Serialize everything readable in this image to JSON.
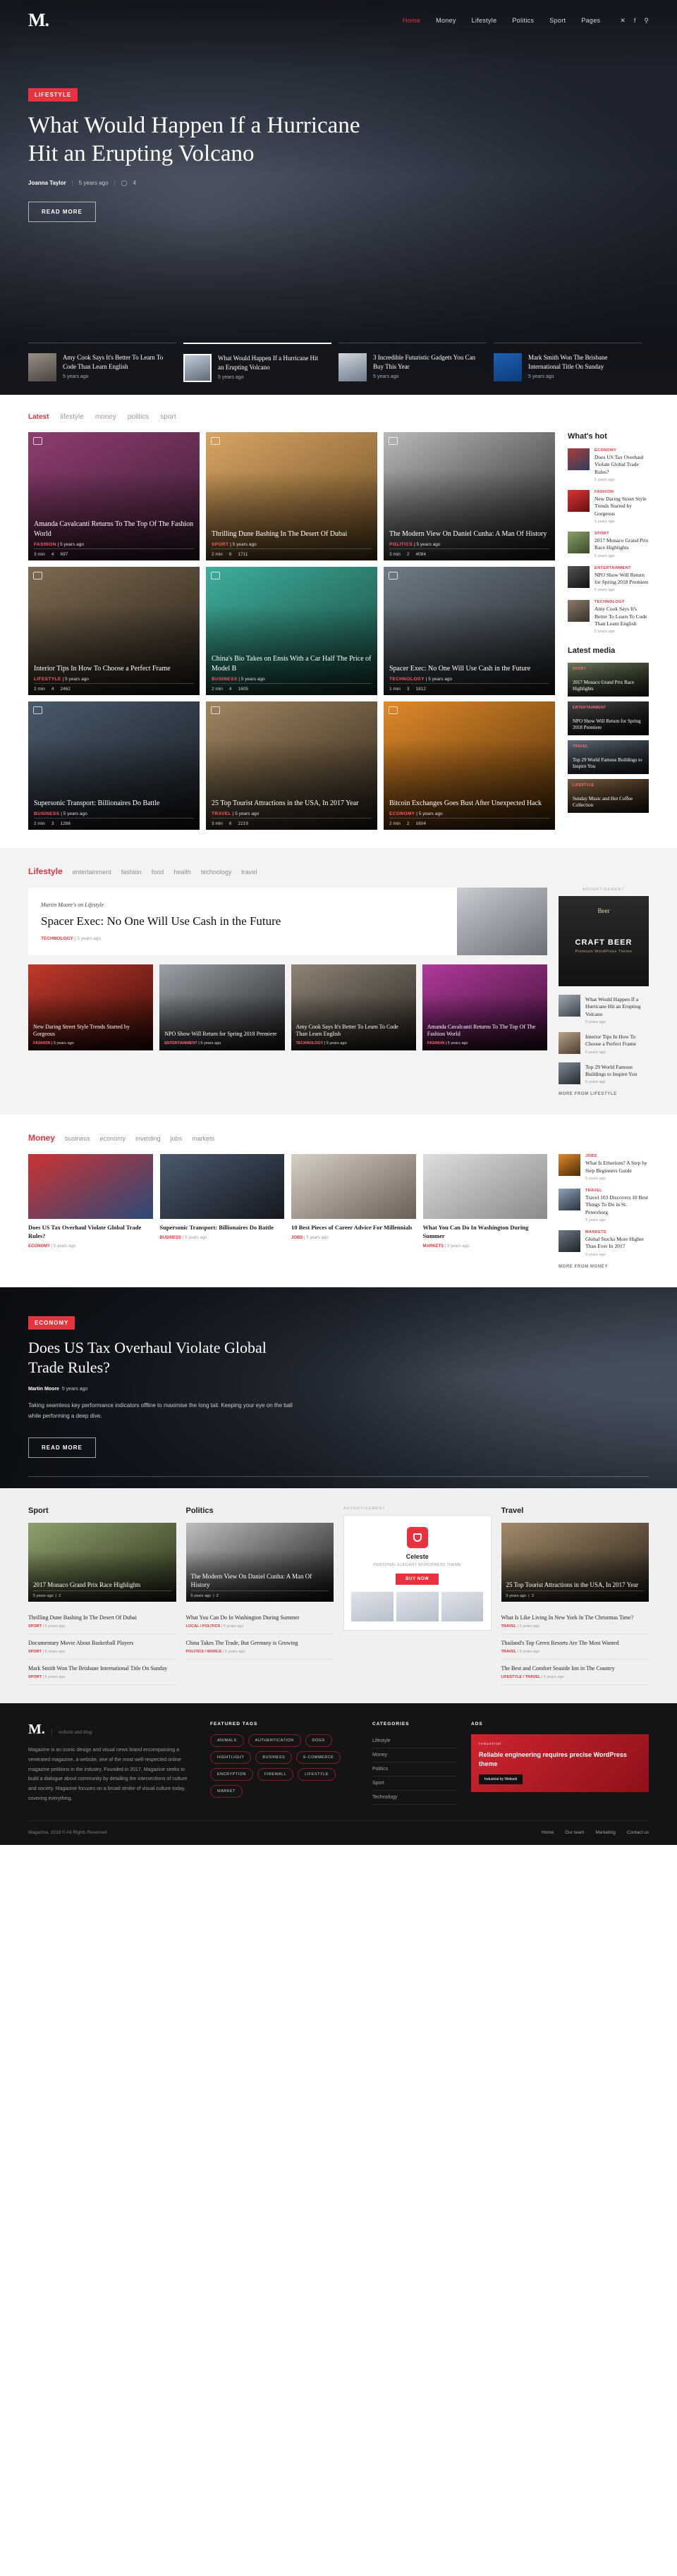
{
  "site": {
    "logo": "M.",
    "tagline": "website and blog"
  },
  "nav": {
    "items": [
      {
        "label": "Home",
        "active": true
      },
      {
        "label": "Money",
        "active": false
      },
      {
        "label": "Lifestyle",
        "active": false
      },
      {
        "label": "Politics",
        "active": false
      },
      {
        "label": "Sport",
        "active": false
      },
      {
        "label": "Pages",
        "active": false
      }
    ],
    "icons": [
      "twitter-icon",
      "facebook-icon",
      "search-icon"
    ],
    "icon_glyphs": [
      "✕",
      "f",
      "⚲"
    ]
  },
  "hero": {
    "badge": "LIFESTYLE",
    "title": "What Would Happen If a Hurricane Hit an Erupting Volcano",
    "author": "Joanna Taylor",
    "date": "5 years ago",
    "comments": "4",
    "button": "READ MORE",
    "carousel": [
      {
        "title": "Amy Cook Says It's Better To Learn To Code Than Learn English",
        "date": "5 years ago",
        "active": false
      },
      {
        "title": "What Would Happen If a Hurricane Hit an Erupting Volcano",
        "date": "5 years ago",
        "active": true
      },
      {
        "title": "3 Incredible Futuristic Gadgets You Can Buy This Year",
        "date": "5 years ago",
        "active": false
      },
      {
        "title": "Mark Smith Won The Brisbane International Title On Sunday",
        "date": "5 years ago",
        "active": false
      }
    ]
  },
  "latest": {
    "tabs": [
      "Latest",
      "lifestyle",
      "money",
      "politics",
      "sport"
    ],
    "active_tab": "Latest",
    "cards": [
      {
        "title": "Amanda Cavalcanti Returns To The Top Of The Fashion World",
        "cat": "FASHION",
        "date": "5 years ago",
        "comments": "3 min",
        "likes": "4",
        "views": "697"
      },
      {
        "title": "Thrilling Dune Bashing In The Desert Of Dubai",
        "cat": "SPORT",
        "date": "5 years ago",
        "comments": "2 min",
        "likes": "6",
        "views": "1711"
      },
      {
        "title": "The Modern View On Daniel Cunha: A Man Of History",
        "cat": "POLITICS",
        "date": "5 years ago",
        "comments": "3 min",
        "likes": "2",
        "views": "4084"
      },
      {
        "title": "Interior Tips In How To Choose a Perfect Frame",
        "cat": "LIFESTYLE",
        "date": "5 years ago",
        "comments": "2 min",
        "likes": "4",
        "views": "2462"
      },
      {
        "title": "China's Bio Takes on Ensis With a Car Half The Price of Model B",
        "cat": "BUSINESS",
        "date": "5 years ago",
        "comments": "2 min",
        "likes": "4",
        "views": "1605"
      },
      {
        "title": "Spacer Exec: No One Will Use Cash in the Future",
        "cat": "TECHNOLOGY",
        "date": "5 years ago",
        "comments": "1 min",
        "likes": "3",
        "views": "1812"
      },
      {
        "title": "Supersonic Transport: Billionaires Do Battle",
        "cat": "BUSINESS",
        "date": "5 years ago",
        "comments": "2 min",
        "likes": "3",
        "views": "1266"
      },
      {
        "title": "25 Top Tourist Attractions in the USA, In 2017 Year",
        "cat": "TRAVEL",
        "date": "5 years ago",
        "comments": "3 min",
        "likes": "6",
        "views": "2219"
      },
      {
        "title": "Bitcoin Exchanges Goes Bust After Unexpected Hack",
        "cat": "ECONOMY",
        "date": "5 years ago",
        "comments": "2 min",
        "likes": "2",
        "views": "1604"
      }
    ]
  },
  "whats_hot": {
    "title": "What's hot",
    "items": [
      {
        "cat": "ECONOMY",
        "title": "Does US Tax Overhaul Violate Global Trade Rules?",
        "date": "5 years ago"
      },
      {
        "cat": "FASHION",
        "title": "New Daring Street Style Trends Started by Gorgeous",
        "date": "5 years ago"
      },
      {
        "cat": "SPORT",
        "title": "2017 Monaco Grand Prix Race Highlights",
        "date": "5 years ago"
      },
      {
        "cat": "ENTERTAINMENT",
        "title": "NPO Show Will Return for Spring 2018 Premiere",
        "date": "5 years ago"
      },
      {
        "cat": "TECHNOLOGY",
        "title": "Amy Cook Says It's Better To Learn To Code Than Learn English",
        "date": "5 years ago"
      }
    ]
  },
  "latest_media": {
    "title": "Latest media",
    "items": [
      {
        "cat": "SPORT",
        "title": "2017 Monaco Grand Prix Race Highlights"
      },
      {
        "cat": "ENTERTAINMENT",
        "title": "NPO Show Will Return for Spring 2018 Premiere"
      },
      {
        "cat": "TRAVEL",
        "title": "Top 29 World Famous Buildings to Inspire You"
      },
      {
        "cat": "LIFESTYLE",
        "title": "Sunday Music and Hot Coffee Collection"
      }
    ]
  },
  "lifestyle": {
    "title": "Lifestyle",
    "tabs": [
      "entertainment",
      "fashion",
      "food",
      "health",
      "technology",
      "travel"
    ],
    "feature": {
      "kicker": "Martin Moore's on Lifestyle",
      "title": "Spacer Exec: No One Will Use Cash in the Future",
      "cat": "TECHNOLOGY",
      "date": "5 years ago"
    },
    "cards": [
      {
        "title": "New Daring Street Style Trends Started by Gorgeous",
        "cat": "FASHION",
        "date": "5 years ago"
      },
      {
        "title": "NPO Show Will Return for Spring 2018 Premiere",
        "cat": "ENTERTAINMENT",
        "date": "5 years ago"
      },
      {
        "title": "Amy Cook Says It's Better To Learn To Code Than Learn English",
        "cat": "TECHNOLOGY",
        "date": "5 years ago"
      },
      {
        "title": "Amanda Cavalcanti Returns To The Top Of The Fashion World",
        "cat": "FASHION",
        "date": "5 years ago"
      }
    ],
    "ad": {
      "label": "ADVERTISEMENT",
      "brand": "Beer",
      "headline": "CRAFT BEER",
      "sub": "Premium WordPress Theme"
    },
    "side_list": [
      {
        "title": "What Would Happen If a Hurricane Hit an Erupting Volcano",
        "date": "5 years ago"
      },
      {
        "title": "Interior Tips In How To Choose a Perfect Frame",
        "date": "5 years ago"
      },
      {
        "title": "Top 29 World Famous Buildings to Inspire You",
        "date": "5 years ago"
      }
    ],
    "more": "MORE FROM LIFESTYLE"
  },
  "money": {
    "title": "Money",
    "tabs": [
      "business",
      "economy",
      "investing",
      "jobs",
      "markets"
    ],
    "cards": [
      {
        "title": "Does US Tax Overhaul Violate Global Trade Rules?",
        "cat": "ECONOMY",
        "date": "5 years ago"
      },
      {
        "title": "Supersonic Transport: Billionaires Do Battle",
        "cat": "BUSINESS",
        "date": "5 years ago"
      },
      {
        "title": "10 Best Pieces of Career Advice For Millennials",
        "cat": "JOBS",
        "date": "5 years ago"
      },
      {
        "title": "What You Can Do In Washington During Summer",
        "cat": "MARKETS",
        "date": "5 years ago"
      }
    ],
    "side_list": [
      {
        "cat": "JOBS",
        "title": "What Is Etherium? A Step by Step Beginners Guide",
        "date": "5 years ago"
      },
      {
        "cat": "TRAVEL",
        "title": "Travel 103 Discovers 10 Best Things To Do in St. Petersburg",
        "date": "5 years ago"
      },
      {
        "cat": "MARKETS",
        "title": "Global Stocks More Higher Than Ever In 2017",
        "date": "5 years ago"
      }
    ],
    "more": "MORE FROM MONEY"
  },
  "promo": {
    "badge": "ECONOMY",
    "title": "Does US Tax Overhaul Violate Global Trade Rules?",
    "author": "Martin Moore",
    "date": "5 years ago",
    "excerpt": "Taking seamless key performance indicators offline to maximise the long tail. Keeping your eye on the ball while performing a deep dive.",
    "button": "READ MORE"
  },
  "bottom": {
    "sport": {
      "title": "Sport",
      "lead": {
        "title": "2017 Monaco Grand Prix Race Highlights",
        "date": "5 years ago",
        "comments": "2"
      },
      "items": [
        {
          "title": "Thrilling Dune Bashing In The Desert Of Dubai",
          "cat": "SPORT",
          "date": "5 years ago"
        },
        {
          "title": "Documentary Movie About Basketball Players",
          "cat": "SPORT",
          "date": "5 years ago"
        },
        {
          "title": "Mark Smith Won The Brisbane International Title On Sunday",
          "cat": "SPORT",
          "date": "5 years ago"
        }
      ]
    },
    "politics": {
      "title": "Politics",
      "lead": {
        "title": "The Modern View On Daniel Cunha: A Man Of History",
        "date": "5 years ago",
        "comments": "2"
      },
      "items": [
        {
          "title": "What You Can Do In Washington During Summer",
          "cat": "LOCAL / POLITICS",
          "date": "5 years ago"
        },
        {
          "title": "China Takes The Trade, But Germany is Growing",
          "cat": "POLITICS / WORLD",
          "date": "5 years ago"
        }
      ]
    },
    "ad": {
      "label": "ADVERTISEMENT",
      "brand": "Celeste",
      "sub": "PERSONAL ELEGANT WORDPRESS THEME",
      "button": "BUY NOW"
    },
    "travel": {
      "title": "Travel",
      "lead": {
        "title": "25 Top Tourist Attractions in the USA, In 2017 Year",
        "date": "5 years ago",
        "comments": "3"
      },
      "items": [
        {
          "title": "What Is Like Living In New York In The Christmas Time?",
          "cat": "TRAVEL",
          "date": "5 years ago"
        },
        {
          "title": "Thailand's Top Green Resorts Are The Most Wanted",
          "cat": "TRAVEL",
          "date": "5 years ago"
        },
        {
          "title": "The Best and Comfort Seaside Inn in The Country",
          "cat": "LIFESTYLE / TRAVEL",
          "date": "5 years ago"
        }
      ]
    }
  },
  "footer": {
    "logo": "M.",
    "tagline": "website and blog",
    "about": "Magazine is an iconic design and visual news brand encompassing a venerated magazine, a website, one of the most well-respected online magazine petitions in the industry. Founded in 2017, Magazine seeks to build a dialogue about community by detailing the intersections of culture and society. Magazine focuses on a broad stroke of visual culture today, covering everything.",
    "tags_title": "FEATURED TAGS",
    "tags": [
      "ANIMALS",
      "AUTHENTICATION",
      "DOGS",
      "HIGHTLIGHT",
      "BUSINESS",
      "E-COMMERCE",
      "ENCRYPTION",
      "FIREWALL",
      "LIFESTYLE",
      "MARKET"
    ],
    "cats_title": "CATEGORIES",
    "cats": [
      "Lifestyle",
      "Money",
      "Politics",
      "Sport",
      "Technology"
    ],
    "ads_title": "ADS",
    "ad": {
      "kicker": "Industrial",
      "headline": "Reliable engineering requires precise WordPress theme",
      "button": "Industrial by Webvek"
    },
    "copyright": "Magazine, 2018 © All Rights Reserved",
    "links": [
      "Home",
      "Our team",
      "Marketing",
      "Contact us"
    ]
  }
}
